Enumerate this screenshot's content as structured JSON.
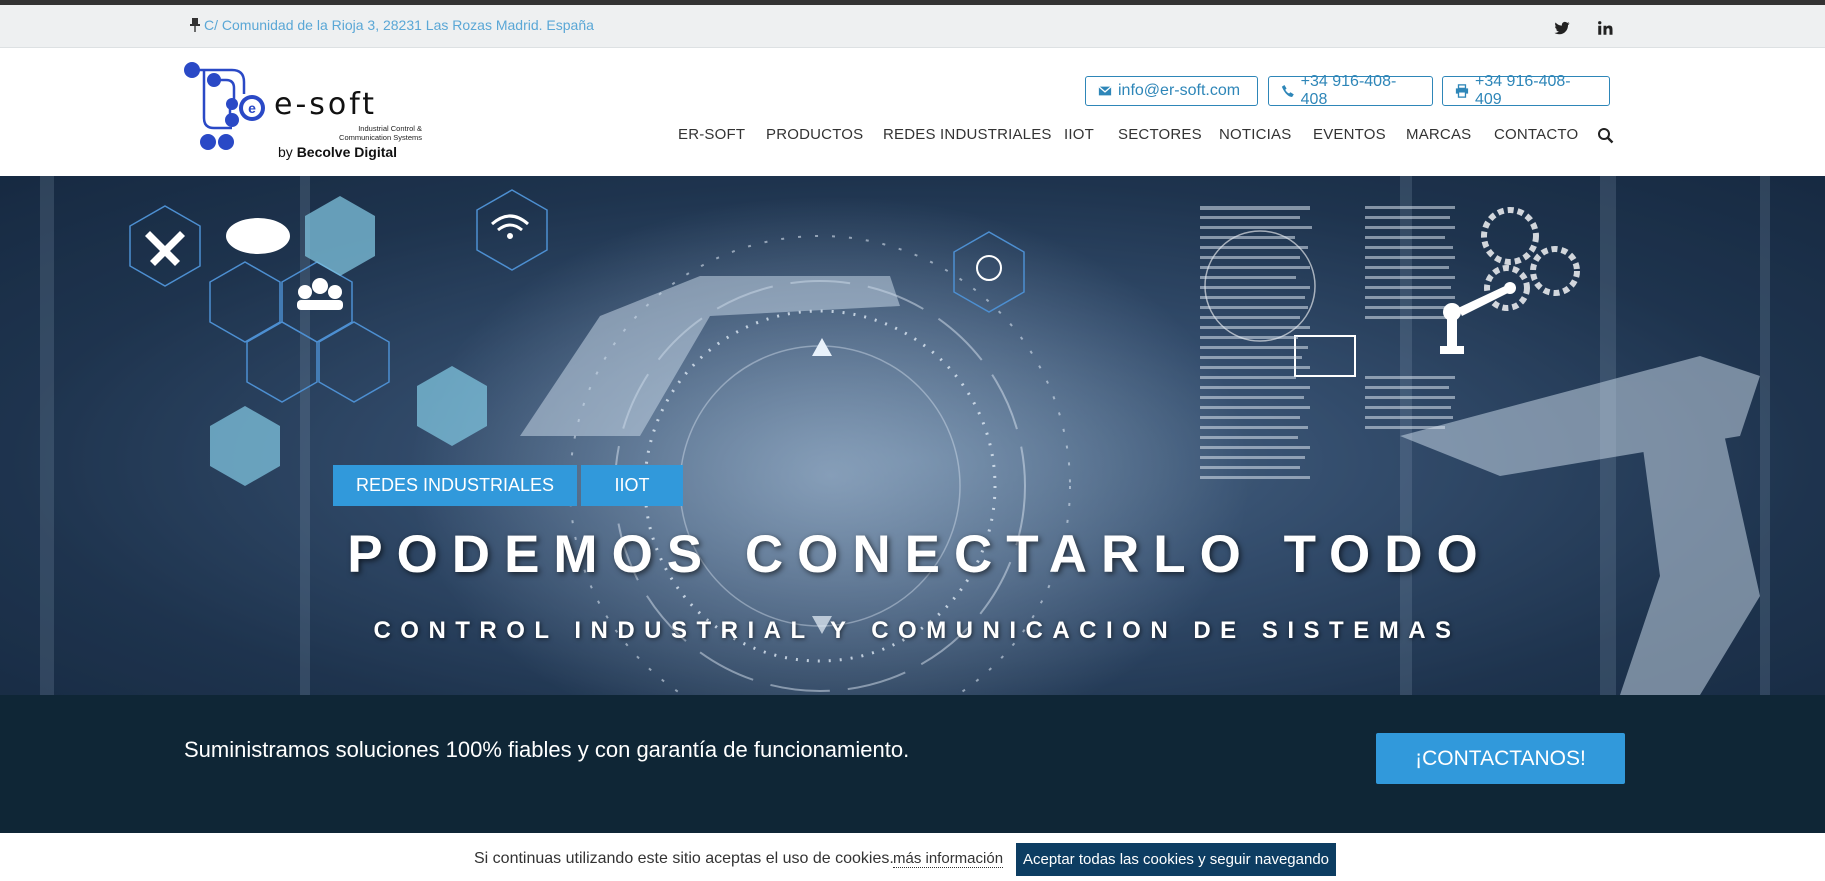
{
  "topbar": {
    "address": "C/ Comunidad de la Rioja 3, 28231 Las Rozas Madrid. España",
    "icons": [
      "pin-icon",
      "twitter-icon",
      "linkedin-icon"
    ]
  },
  "header": {
    "logo": {
      "brand": "e-soft",
      "tagline1": "Industrial Control &",
      "tagline2": "Communication Systems",
      "by_prefix": "by",
      "by_name": "Becolve Digital"
    },
    "contacts": {
      "email": "info@er-soft.com",
      "phone": "+34 916-408-408",
      "fax": "+34 916-408-409"
    },
    "nav": [
      "ER-SOFT",
      "PRODUCTOS",
      "REDES INDUSTRIALES",
      "IIOT",
      "SECTORES",
      "NOTICIAS",
      "EVENTOS",
      "MARCAS",
      "CONTACTO"
    ]
  },
  "hero": {
    "tags": [
      "REDES INDUSTRIALES",
      "IIOT"
    ],
    "title": "PODEMOS CONECTARLO TODO",
    "subtitle": "CONTROL INDUSTRIAL Y COMUNICACION DE SISTEMAS"
  },
  "band": {
    "text": "Suministramos soluciones 100% fiables y con garantía de funcionamiento.",
    "cta": "¡CONTACTANOS!"
  },
  "cookie": {
    "text": "Si continuas utilizando este sitio aceptas el uso de cookies.",
    "more": "más información",
    "accept": "Aceptar todas las cookies y seguir navegando"
  },
  "colors": {
    "accent": "#3199db",
    "link": "#2e86b8",
    "band": "#0f2636",
    "cookie_button": "#0d3d62"
  }
}
